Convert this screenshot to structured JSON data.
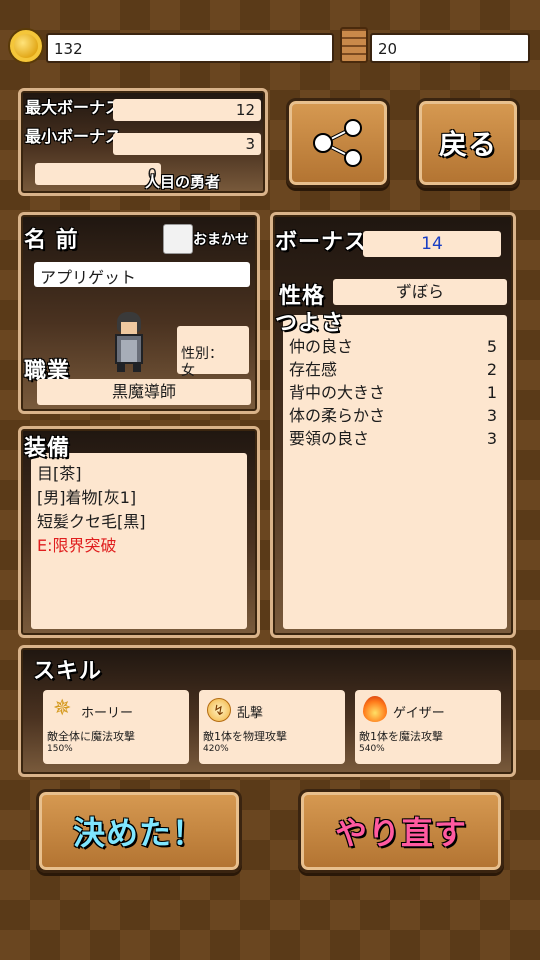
{
  "header": {
    "coins": "132",
    "bricks": "20"
  },
  "bonus_box": {
    "max_label": "最大ボーナス",
    "max_value": "12",
    "min_label": "最小ボーナス",
    "min_value": "3",
    "hero_count": "0",
    "hero_suffix": "人目の勇者"
  },
  "buttons": {
    "back": "戻る",
    "decide": "決めた！",
    "redo": "やり直す"
  },
  "name_panel": {
    "title": "名 前",
    "omakase": "おまかせ",
    "name": "アプリゲット",
    "gender": "性別：\n女",
    "job_title": "職業",
    "job": "黒魔導師"
  },
  "stats_panel": {
    "bonus_label": "ボーナス",
    "bonus_value": "14",
    "personality_label": "性格",
    "personality_value": "ずぼら",
    "strength_label": "つよさ",
    "stats": [
      {
        "name": "仲の良さ",
        "value": "5"
      },
      {
        "name": "存在感",
        "value": "2"
      },
      {
        "name": "背中の大きさ",
        "value": "1"
      },
      {
        "name": "体の柔らかさ",
        "value": "3"
      },
      {
        "name": "要領の良さ",
        "value": "3"
      }
    ]
  },
  "equip_panel": {
    "title": "装備",
    "items": [
      "目[茶]",
      "[男]着物[灰1]",
      "短髪クセ毛[黒]",
      "E:限界突破"
    ]
  },
  "skills_panel": {
    "title": "スキル",
    "skills": [
      {
        "name": "ホーリー",
        "desc": "敵全体に魔法攻撃",
        "pct": "150%"
      },
      {
        "name": "乱撃",
        "desc": "敵1体を物理攻撃",
        "pct": "420%"
      },
      {
        "name": "ゲイザー",
        "desc": "敵1体を魔法攻撃",
        "pct": "540%"
      }
    ]
  },
  "colors": {
    "accent_red": "#e01e1e",
    "bonus_blue": "#1a3fc4",
    "decide_text": "#7fe6ff",
    "redo_text": "#ff5aa0"
  }
}
